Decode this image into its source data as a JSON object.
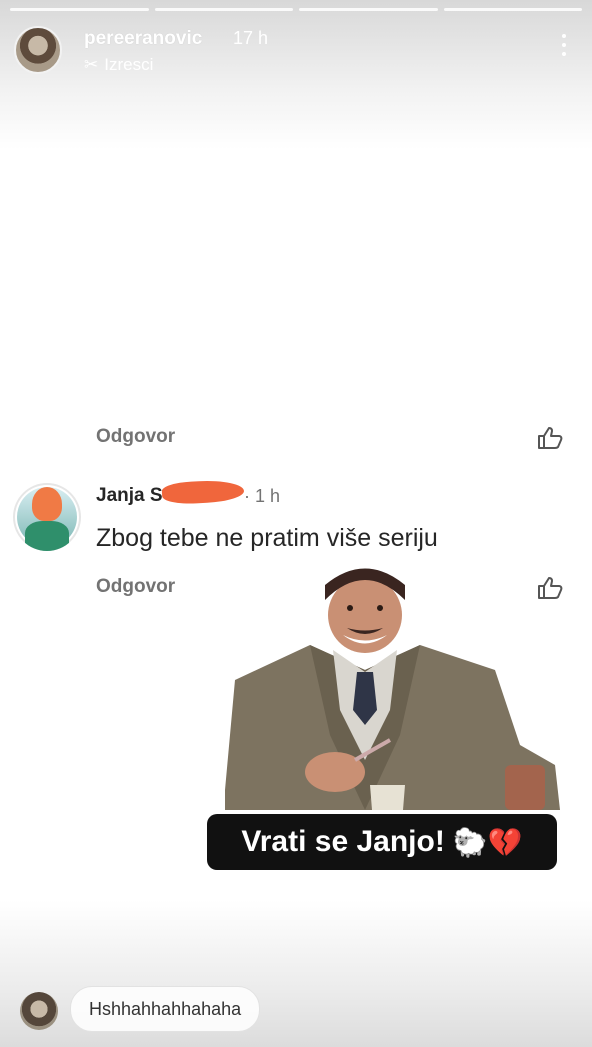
{
  "story": {
    "progress_segments": 4,
    "username": "pereeranovic",
    "time": "17 h",
    "subtitle": "Izresci",
    "subtitle_icon": "scissors-icon",
    "menu_icon": "more-vertical-icon"
  },
  "comments": {
    "reply_label_1": "Odgovor",
    "reply_label_2": "Odgovor",
    "comment": {
      "name": "Janja S",
      "time": "· 1 h",
      "text": "Zbog tebe ne pratim više seriju"
    }
  },
  "sticker": {
    "caption": "Vrati se Janjo!",
    "emoji": "🐑💔"
  },
  "reply_bar": {
    "text": "Hshhahhahhahaha"
  },
  "colors": {
    "redaction": "#f0663c",
    "caption_bg": "#111111",
    "muted_text": "#737373"
  }
}
